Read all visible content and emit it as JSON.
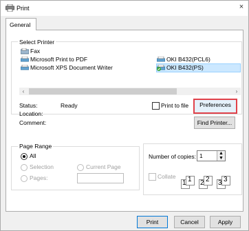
{
  "window": {
    "title": "Print",
    "close": "×"
  },
  "tabs": [
    {
      "label": "General"
    }
  ],
  "select_printer": {
    "label": "Select Printer",
    "printers": [
      {
        "name": "Fax"
      },
      {
        "name": "Microsoft Print to PDF"
      },
      {
        "name": "Microsoft XPS Document Writer"
      },
      {
        "name": "OKI B432(PCL6)"
      },
      {
        "name": "OKI B432(PS)"
      }
    ],
    "selected": "OKI B432(PS)"
  },
  "scroll": {
    "left": "‹",
    "right": "›"
  },
  "status": {
    "status_label": "Status:",
    "status_value": "Ready",
    "location_label": "Location:",
    "comment_label": "Comment:"
  },
  "print_to_file": {
    "label": "Print to file",
    "checked": false
  },
  "buttons": {
    "preferences": "Preferences",
    "find_printer": "Find Printer...",
    "print": "Print",
    "cancel": "Cancel",
    "apply": "Apply"
  },
  "page_range": {
    "label": "Page Range",
    "all": "All",
    "selection": "Selection",
    "current_page": "Current Page",
    "pages": "Pages:",
    "selected": "All"
  },
  "copies": {
    "label": "Number of copies:",
    "value": "1",
    "collate_label": "Collate",
    "collate_checked": false,
    "collate_pages": [
      "1",
      "1",
      "2",
      "2",
      "3",
      "3"
    ]
  },
  "colors": {
    "accent": "#e0414a",
    "selection": "#cce8ff"
  }
}
